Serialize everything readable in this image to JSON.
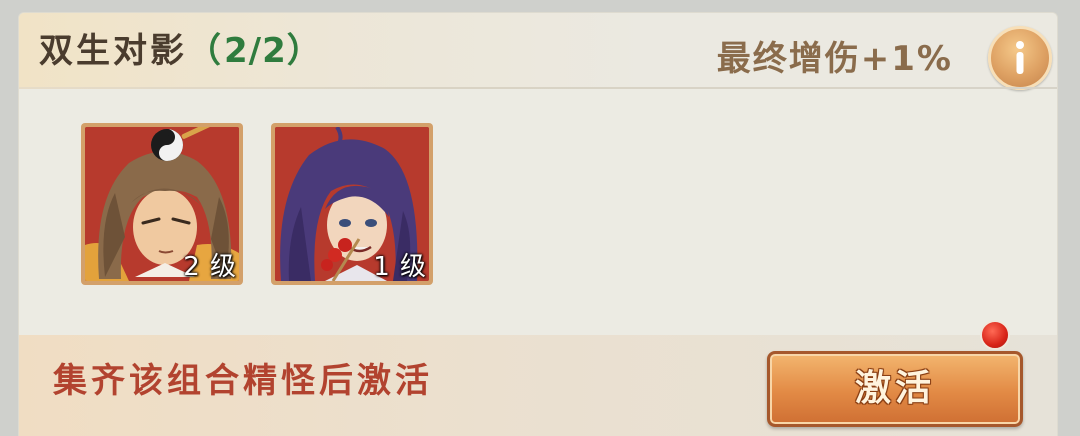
{
  "header": {
    "title": "双生对影",
    "count_open": "（",
    "count": "2/2",
    "count_close": "）",
    "bonus": "最终增伤+1%",
    "info_icon": "info-icon"
  },
  "cards": [
    {
      "portrait": "long-haired-man-with-yin-yang-headpiece",
      "level": "2 级"
    },
    {
      "portrait": "purple-haired-girl-with-candied-haws",
      "level": "1 级"
    }
  ],
  "footer": {
    "hint": "集齐该组合精怪后激活",
    "activate_label": "激活"
  },
  "colors": {
    "title_text": "#4a3c2e",
    "count_green": "#2f7c3e",
    "bonus_text": "#8a6c4c",
    "hint_red": "#b2432f",
    "button_orange": "#e28a45",
    "badge_red": "#d82418",
    "card_bg": "#b73a2d"
  }
}
